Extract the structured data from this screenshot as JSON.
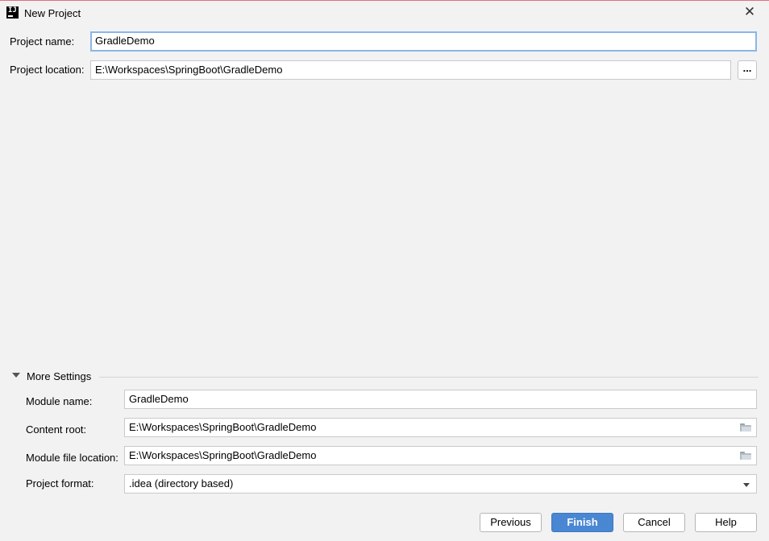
{
  "window": {
    "title": "New Project",
    "app_icon_text": "IJ"
  },
  "project": {
    "name_label": "Project name:",
    "name_value": "GradleDemo",
    "location_label": "Project location:",
    "location_value": "E:\\Workspaces\\SpringBoot\\GradleDemo",
    "browse_label": "..."
  },
  "more_settings": {
    "title": "More Settings",
    "expanded": true,
    "module_name_label": "Module name:",
    "module_name_value": "GradleDemo",
    "content_root_label": "Content root:",
    "content_root_value": "E:\\Workspaces\\SpringBoot\\GradleDemo",
    "module_file_location_label": "Module file location:",
    "module_file_location_value": "E:\\Workspaces\\SpringBoot\\GradleDemo",
    "project_format_label": "Project format:",
    "project_format_value": ".idea (directory based)"
  },
  "buttons": {
    "previous": "Previous",
    "finish": "Finish",
    "cancel": "Cancel",
    "help": "Help"
  },
  "colors": {
    "background": "#f2f2f2",
    "primary_button": "#4a87d3",
    "focus_border": "#89b6e8",
    "top_accent": "#e36d84"
  }
}
